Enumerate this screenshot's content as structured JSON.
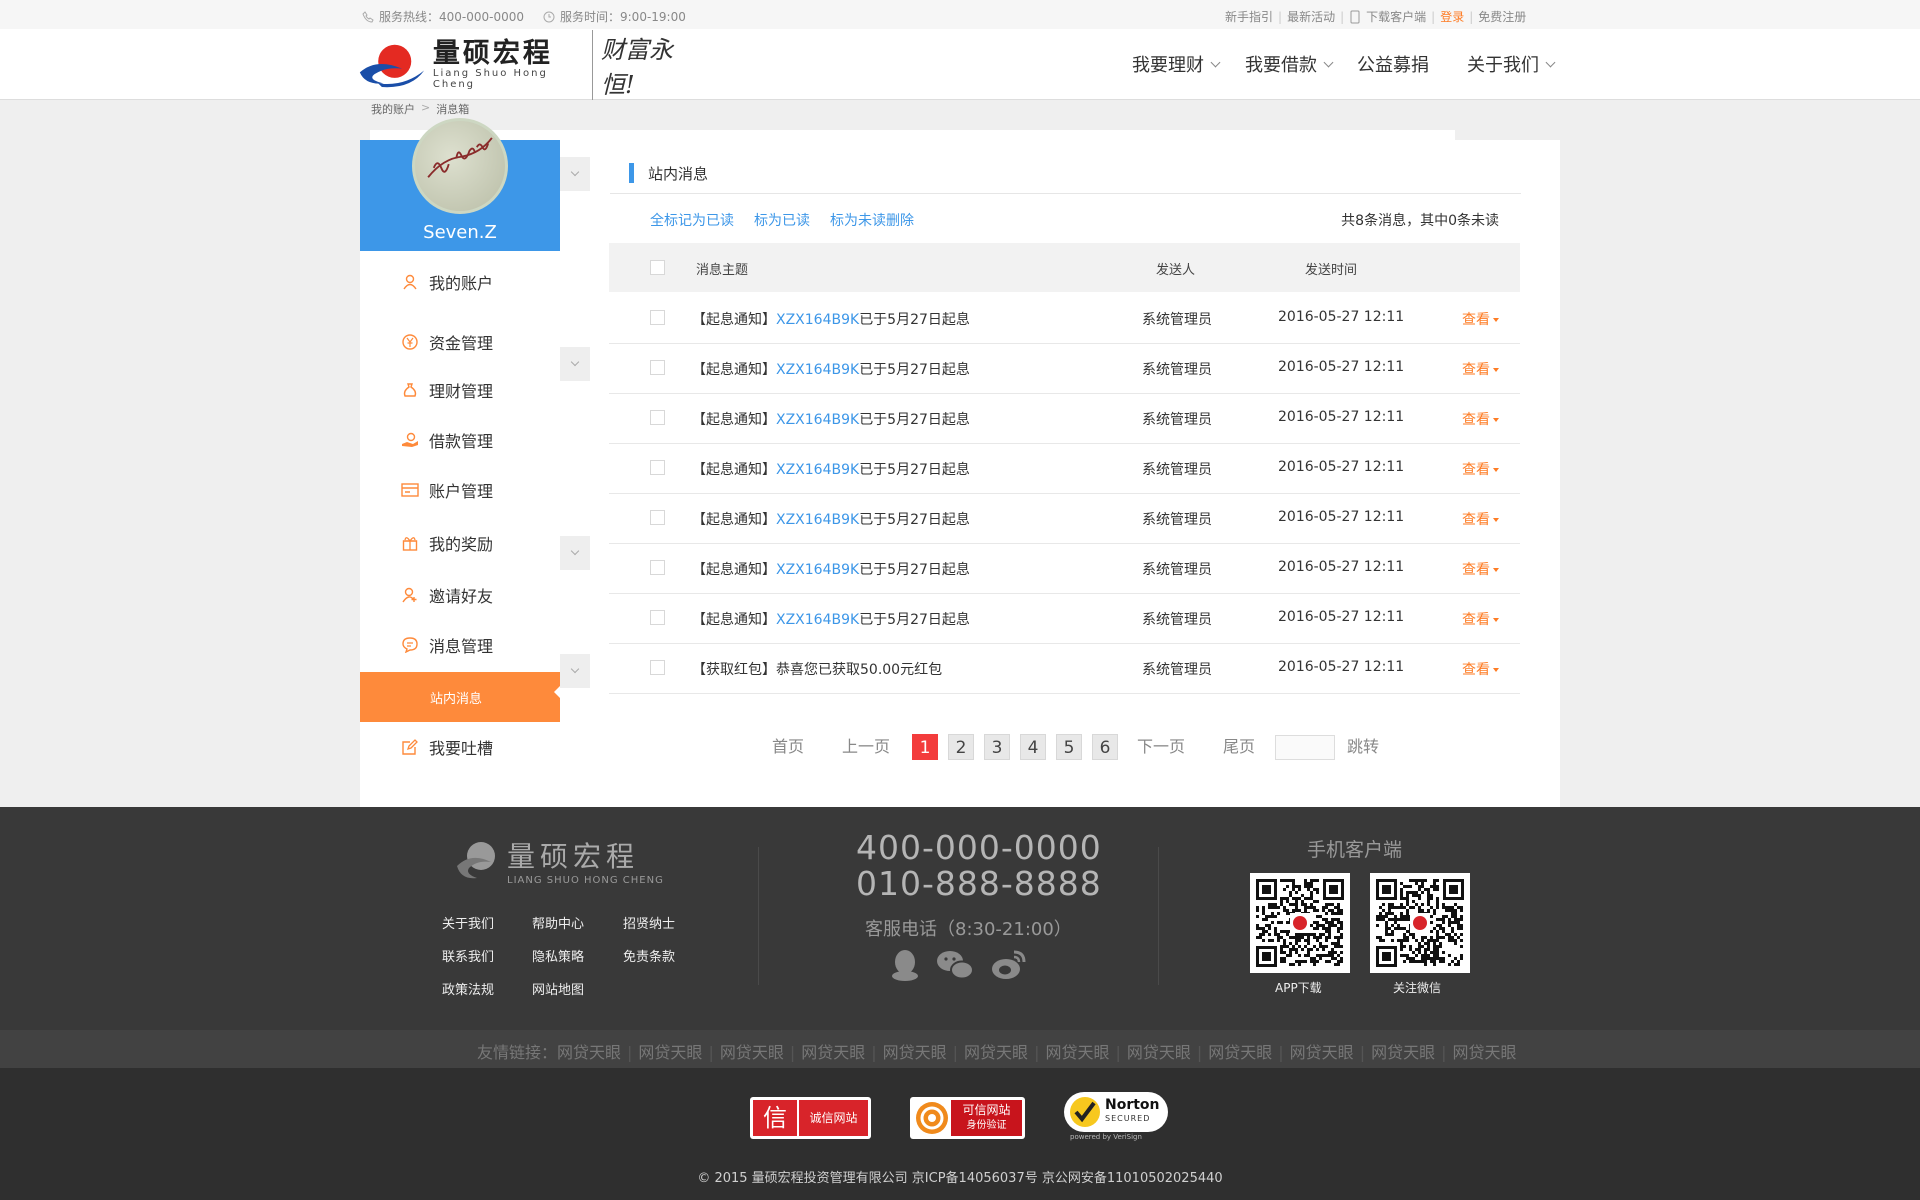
{
  "topbar": {
    "hotline": "服务热线：400-000-0000",
    "service_time": "服务时间：9:00-19:00",
    "guide": "新手指引",
    "activities": "最新活动",
    "download": "下载客户端",
    "login": "登录",
    "register": "免费注册"
  },
  "header": {
    "logo_cn": "量硕宏程",
    "logo_en": "Liang Shuo Hong Cheng",
    "slogan": "财富永恒!",
    "nav": [
      "我要理财",
      "我要借款",
      "公益募捐",
      "关于我们"
    ]
  },
  "breadcrumb": [
    "我的账户",
    "消息箱"
  ],
  "profile": {
    "name": "Seven.Z"
  },
  "sidebar": {
    "items": [
      "我的账户",
      "资金管理",
      "理财管理",
      "借款管理",
      "账户管理",
      "我的奖励",
      "邀请好友",
      "消息管理",
      "站内消息",
      "我要吐槽"
    ]
  },
  "main": {
    "title": "站内消息",
    "actions": [
      "全标记为已读",
      "标为已读",
      "标为未读删除"
    ],
    "count_text": "共8条消息，其中0条未读",
    "columns": [
      "消息主题",
      "发送人",
      "发送时间"
    ],
    "rows": [
      {
        "prefix": "【起息通知】",
        "code": "XZX164B9K",
        "suffix": "已于5月27日起息",
        "sender": "系统管理员",
        "time": "2016-05-27 12:11",
        "action": "查看"
      },
      {
        "prefix": "【起息通知】",
        "code": "XZX164B9K",
        "suffix": "已于5月27日起息",
        "sender": "系统管理员",
        "time": "2016-05-27 12:11",
        "action": "查看"
      },
      {
        "prefix": "【起息通知】",
        "code": "XZX164B9K",
        "suffix": "已于5月27日起息",
        "sender": "系统管理员",
        "time": "2016-05-27 12:11",
        "action": "查看"
      },
      {
        "prefix": "【起息通知】",
        "code": "XZX164B9K",
        "suffix": "已于5月27日起息",
        "sender": "系统管理员",
        "time": "2016-05-27 12:11",
        "action": "查看"
      },
      {
        "prefix": "【起息通知】",
        "code": "XZX164B9K",
        "suffix": "已于5月27日起息",
        "sender": "系统管理员",
        "time": "2016-05-27 12:11",
        "action": "查看"
      },
      {
        "prefix": "【起息通知】",
        "code": "XZX164B9K",
        "suffix": "已于5月27日起息",
        "sender": "系统管理员",
        "time": "2016-05-27 12:11",
        "action": "查看"
      },
      {
        "prefix": "【起息通知】",
        "code": "XZX164B9K",
        "suffix": "已于5月27日起息",
        "sender": "系统管理员",
        "time": "2016-05-27 12:11",
        "action": "查看"
      },
      {
        "prefix": "【获取红包】",
        "code": "",
        "suffix": "恭喜您已获取50.00元红包",
        "sender": "系统管理员",
        "time": "2016-05-27 12:11",
        "action": "查看"
      }
    ]
  },
  "pagination": {
    "first": "首页",
    "prev": "上一页",
    "pages": [
      "1",
      "2",
      "3",
      "4",
      "5",
      "6"
    ],
    "current": "1",
    "next": "下一页",
    "last": "尾页",
    "jump": "跳转"
  },
  "footer": {
    "logo_cn": "量硕宏程",
    "logo_en": "LIANG SHUO  HONG CHENG",
    "links": [
      "关于我们",
      "帮助中心",
      "招贤纳士",
      "联系我们",
      "隐私策略",
      "免责条款",
      "政策法规",
      "网站地图"
    ],
    "phone1": "400-000-0000",
    "phone2": "010-888-8888",
    "service": "客服电话（8:30-21:00）",
    "app_title": "手机客户端",
    "qr_labels": [
      "APP下载",
      "关注微信"
    ],
    "friend_label": "友情链接：",
    "friend_links": [
      "网贷天眼",
      "网贷天眼",
      "网贷天眼",
      "网贷天眼",
      "网贷天眼",
      "网贷天眼",
      "网贷天眼",
      "网贷天眼",
      "网贷天眼",
      "网贷天眼",
      "网贷天眼",
      "网贷天眼"
    ],
    "badges": [
      "诚信网站",
      "可信网站",
      "身份验证",
      "Norton",
      "SECURED",
      "powered by VeriSign"
    ],
    "copyright": "© 2015 量硕宏程投资管理有限公司 京ICP备14056037号 京公网安备11010502025440"
  },
  "colors": {
    "blue": "#3d97e8",
    "orange": "#fe8a3b",
    "red": "#f33c3c"
  }
}
